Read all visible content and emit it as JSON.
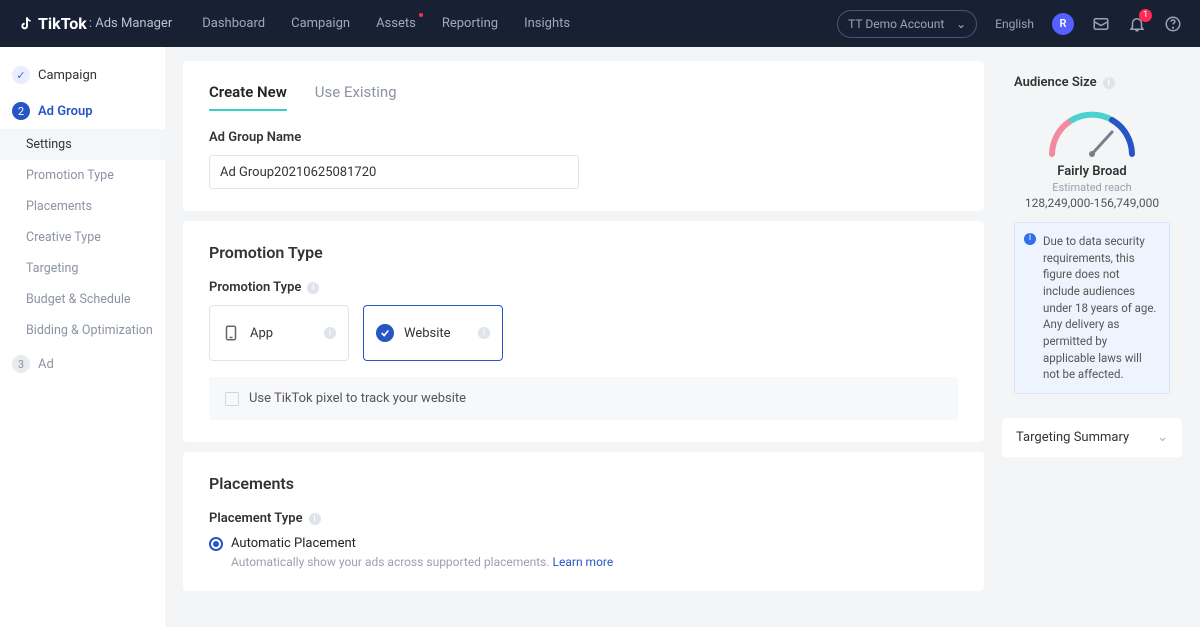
{
  "header": {
    "brand_main": "TikTok",
    "brand_sub": ": Ads Manager",
    "nav": [
      "Dashboard",
      "Campaign",
      "Assets",
      "Reporting",
      "Insights"
    ],
    "account_label": "TT Demo Account",
    "language": "English",
    "avatar_initial": "R",
    "bell_badge": "1"
  },
  "sidebar": {
    "steps": [
      {
        "label": "Campaign"
      },
      {
        "label": "Ad Group",
        "num": "2"
      },
      {
        "label": "Ad",
        "num": "3"
      }
    ],
    "subs": [
      "Settings",
      "Promotion Type",
      "Placements",
      "Creative Type",
      "Targeting",
      "Budget & Schedule",
      "Bidding & Optimization"
    ]
  },
  "tabs": {
    "create": "Create New",
    "use": "Use Existing"
  },
  "adgroup": {
    "name_label": "Ad Group Name",
    "name_value": "Ad Group20210625081720"
  },
  "promotion": {
    "section": "Promotion Type",
    "label": "Promotion Type",
    "app": "App",
    "website": "Website",
    "pixel_text": "Use TikTok pixel to track your website"
  },
  "placements": {
    "section": "Placements",
    "type_label": "Placement Type",
    "auto_label": "Automatic Placement",
    "auto_help": "Automatically show your ads across supported placements.",
    "learn_more": "Learn more"
  },
  "audience": {
    "title": "Audience Size",
    "status": "Fairly Broad",
    "est_label": "Estimated reach",
    "range": "128,249,000-156,749,000",
    "notice": "Due to data security requirements, this figure does not include audiences under 18 years of age. Any delivery as permitted by applicable laws will not be affected."
  },
  "targeting_summary": "Targeting Summary"
}
